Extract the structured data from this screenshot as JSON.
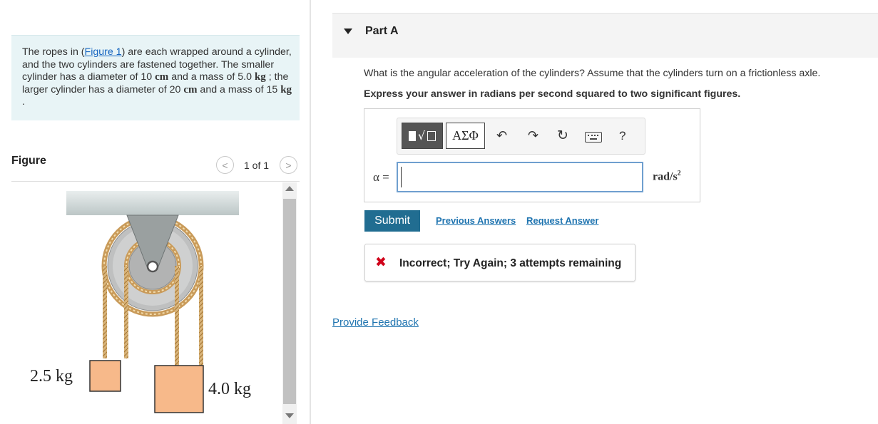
{
  "problem": {
    "before_link": "The ropes in (",
    "link": "Figure 1",
    "after_link": ") are each wrapped around a cylinder, and the two cylinders are fastened together. The smaller cylinder has a diameter of 10 ",
    "unit_cm": "cm",
    "mid1": " and a mass of 5.0 ",
    "unit_kg": "kg",
    "mid2": " ; the larger cylinder has a diameter of 20 ",
    "unit_cm2": "cm",
    "mid3": " and a mass of 15 ",
    "unit_kg2": "kg",
    "end": " ."
  },
  "figure": {
    "label": "Figure",
    "prev_glyph": "<",
    "next_glyph": ">",
    "count": "1 of 1",
    "mass_left": "2.5 kg",
    "mass_right": "4.0 kg"
  },
  "part": {
    "title": "Part A",
    "question": "What is the angular acceleration of the cylinders? Assume that the cylinders turn on a frictionless axle.",
    "instruction": "Express your answer in radians per second squared to two significant figures."
  },
  "toolbar": {
    "template_radical": "√",
    "greek_label": "ΑΣΦ",
    "undo_glyph": "↶",
    "redo_glyph": "↷",
    "reset_glyph": "↻",
    "help_glyph": "?"
  },
  "answer": {
    "variable": "α =",
    "value": "",
    "unit_base": "rad/s",
    "unit_exp": "2"
  },
  "actions": {
    "submit": "Submit",
    "previous_answers": "Previous Answers",
    "request_answer": "Request Answer"
  },
  "feedback": {
    "icon": "✖",
    "message": "Incorrect; Try Again; 3 attempts remaining"
  },
  "footer": {
    "provide_feedback": "Provide Feedback"
  },
  "colors": {
    "problem_bg": "#e8f4f6",
    "submit_bg": "#216d91",
    "link": "#1f74b0",
    "error": "#d0021b",
    "mass_fill": "#f7b98a"
  }
}
